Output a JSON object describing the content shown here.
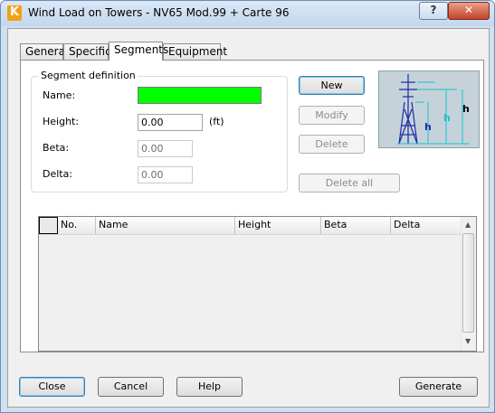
{
  "window": {
    "title": "Wind Load on Towers - NV65 Mod.99 + Carte 96",
    "help_btn": "?",
    "close_btn": "✕"
  },
  "tabs": [
    {
      "label": "General"
    },
    {
      "label": "Specific"
    },
    {
      "label": "Segments",
      "active": true
    },
    {
      "label": "Equipment"
    }
  ],
  "segment_definition": {
    "group_label": "Segment definition",
    "name_label": "Name:",
    "name_value": "",
    "name_color": "#00ff00",
    "height_label": "Height:",
    "height_value": "0.00",
    "height_unit": "(ft)",
    "beta_label": "Beta:",
    "beta_value": "0.00",
    "delta_label": "Delta:",
    "delta_value": "0.00"
  },
  "actions": {
    "new": "New",
    "modify": "Modify",
    "delete": "Delete",
    "delete_all": "Delete all"
  },
  "diagram": {
    "h_label": "h",
    "image_name": "tower-diagram"
  },
  "table": {
    "columns": [
      "No.",
      "Name",
      "Height",
      "Beta",
      "Delta"
    ],
    "rows": []
  },
  "footer": {
    "close": "Close",
    "cancel": "Cancel",
    "help": "Help",
    "generate": "Generate"
  },
  "colors": {
    "accent": "#3c7fb1",
    "name_field": "#00ff00"
  }
}
